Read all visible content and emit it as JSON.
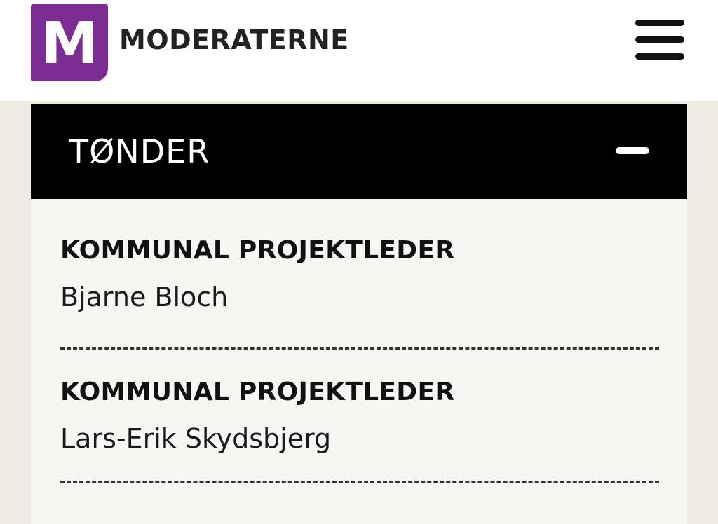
{
  "header": {
    "logo_letter": "M",
    "brand_name": "MODERATERNE",
    "brand_color": "#7b2d93"
  },
  "accordion": {
    "title": "TØNDER",
    "expanded": true,
    "entries": [
      {
        "role": "KOMMUNAL PROJEKTLEDER",
        "name": "Bjarne Bloch"
      },
      {
        "role": "KOMMUNAL PROJEKTLEDER",
        "name": "Lars-Erik Skydsbjerg"
      }
    ]
  },
  "icons": {
    "menu": "hamburger-menu-icon",
    "collapse": "minus-icon"
  }
}
